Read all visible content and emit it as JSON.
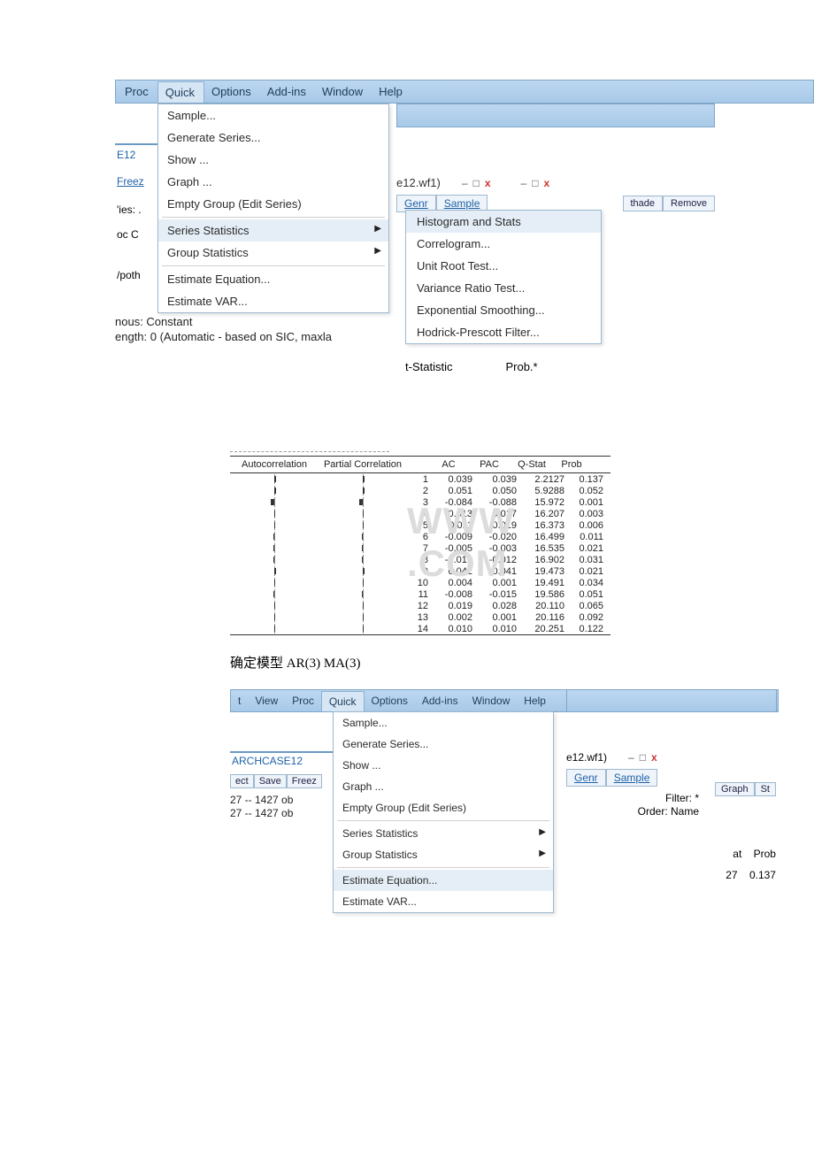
{
  "menubar1": {
    "items": [
      "Proc",
      "Quick",
      "Options",
      "Add-ins",
      "Window",
      "Help"
    ],
    "active": "Quick"
  },
  "quick_menu": {
    "items": [
      {
        "label": "Sample..."
      },
      {
        "label": "Generate Series..."
      },
      {
        "label": "Show ..."
      },
      {
        "label": "Graph ..."
      },
      {
        "label": "Empty Group (Edit Series)"
      },
      {
        "sep": true
      },
      {
        "label": "Series Statistics",
        "arrow": true,
        "hover": true
      },
      {
        "label": "Group Statistics",
        "arrow": true
      },
      {
        "sep": true
      },
      {
        "label": "Estimate Equation..."
      },
      {
        "label": "Estimate VAR..."
      }
    ]
  },
  "left_strip": {
    "e12": "E12",
    "freez": "Freez",
    "ies": "'ies: .",
    "ocC": "oc C",
    "poth": "/poth"
  },
  "below1": "nous: Constant",
  "below2": "ength: 0 (Automatic - based on SIC, maxla",
  "right_window": {
    "file": "e12.wf1)",
    "genr": "Genr",
    "sample": "Sample",
    "thade": "thade",
    "remove": "Remove"
  },
  "second_win_ctrl": true,
  "series_stats_submenu": {
    "items": [
      {
        "label": "Histogram and Stats",
        "hl": true
      },
      {
        "label": "Correlogram..."
      },
      {
        "label": "Unit Root Test..."
      },
      {
        "label": "Variance Ratio Test..."
      },
      {
        "label": "Exponential Smoothing..."
      },
      {
        "label": "Hodrick-Prescott Filter..."
      }
    ]
  },
  "footer_labels": {
    "tstat": "t-Statistic",
    "prob": "Prob.*"
  },
  "ctable": {
    "headers": [
      "Autocorrelation",
      "Partial Correlation",
      "",
      "AC",
      "PAC",
      "Q-Stat",
      "Prob"
    ],
    "rows": [
      {
        "i": 1,
        "ac": 0.039,
        "pac": 0.039,
        "q": "2.2127",
        "p": "0.137"
      },
      {
        "i": 2,
        "ac": 0.051,
        "pac": 0.05,
        "q": "5.9288",
        "p": "0.052"
      },
      {
        "i": 3,
        "ac": -0.084,
        "pac": -0.088,
        "q": "15.972",
        "p": "0.001"
      },
      {
        "i": 4,
        "ac": 0.013,
        "pac": 0.017,
        "q": "16.207",
        "p": "0.003"
      },
      {
        "i": 5,
        "ac": 0.011,
        "pac": 0.019,
        "q": "16.373",
        "p": "0.006"
      },
      {
        "i": 6,
        "ac": -0.009,
        "pac": -0.02,
        "q": "16.499",
        "p": "0.011"
      },
      {
        "i": 7,
        "ac": -0.005,
        "pac": -0.003,
        "q": "16.535",
        "p": "0.021"
      },
      {
        "i": 8,
        "ac": -0.016,
        "pac": -0.012,
        "q": "16.902",
        "p": "0.031"
      },
      {
        "i": 9,
        "ac": 0.042,
        "pac": 0.041,
        "q": "19.473",
        "p": "0.021"
      },
      {
        "i": 10,
        "ac": 0.004,
        "pac": 0.001,
        "q": "19.491",
        "p": "0.034"
      },
      {
        "i": 11,
        "ac": -0.008,
        "pac": -0.015,
        "q": "19.586",
        "p": "0.051"
      },
      {
        "i": 12,
        "ac": 0.019,
        "pac": 0.028,
        "q": "20.110",
        "p": "0.065"
      },
      {
        "i": 13,
        "ac": 0.002,
        "pac": 0.001,
        "q": "20.116",
        "p": "0.092"
      },
      {
        "i": 14,
        "ac": 0.01,
        "pac": 0.01,
        "q": "20.251",
        "p": "0.122"
      }
    ]
  },
  "watermark": "WWW          .COM",
  "caption": "确定模型 AR(3) MA(3)",
  "menubar2": {
    "items": [
      "t",
      "View",
      "Proc",
      "Quick",
      "Options",
      "Add-ins",
      "Window",
      "Help"
    ],
    "active": "Quick"
  },
  "bot_left": {
    "arch": "ARCHCASE12",
    "ect": "ect",
    "save": "Save",
    "freez": "Freez",
    "obs1": "27   --   1427 ob",
    "obs2": "27   --   1427 ob"
  },
  "quick_menu2": {
    "items": [
      {
        "label": "Sample..."
      },
      {
        "label": "Generate Series..."
      },
      {
        "label": "Show ..."
      },
      {
        "label": "Graph ..."
      },
      {
        "label": "Empty Group (Edit Series)"
      },
      {
        "sep": true
      },
      {
        "label": "Series Statistics",
        "arrow": true
      },
      {
        "label": "Group Statistics",
        "arrow": true
      },
      {
        "sep": true
      },
      {
        "label": "Estimate Equation...",
        "hl": true
      },
      {
        "label": "Estimate VAR..."
      }
    ]
  },
  "bot_right": {
    "file": "e12.wf1)",
    "genr": "Genr",
    "sample": "Sample",
    "filter": "Filter: *",
    "order": "Order: Name"
  },
  "bot_right_far": {
    "graph": "Graph",
    "st": "St",
    "at": "at",
    "prob": "Prob",
    "v1": "27",
    "v2": "0.137"
  }
}
